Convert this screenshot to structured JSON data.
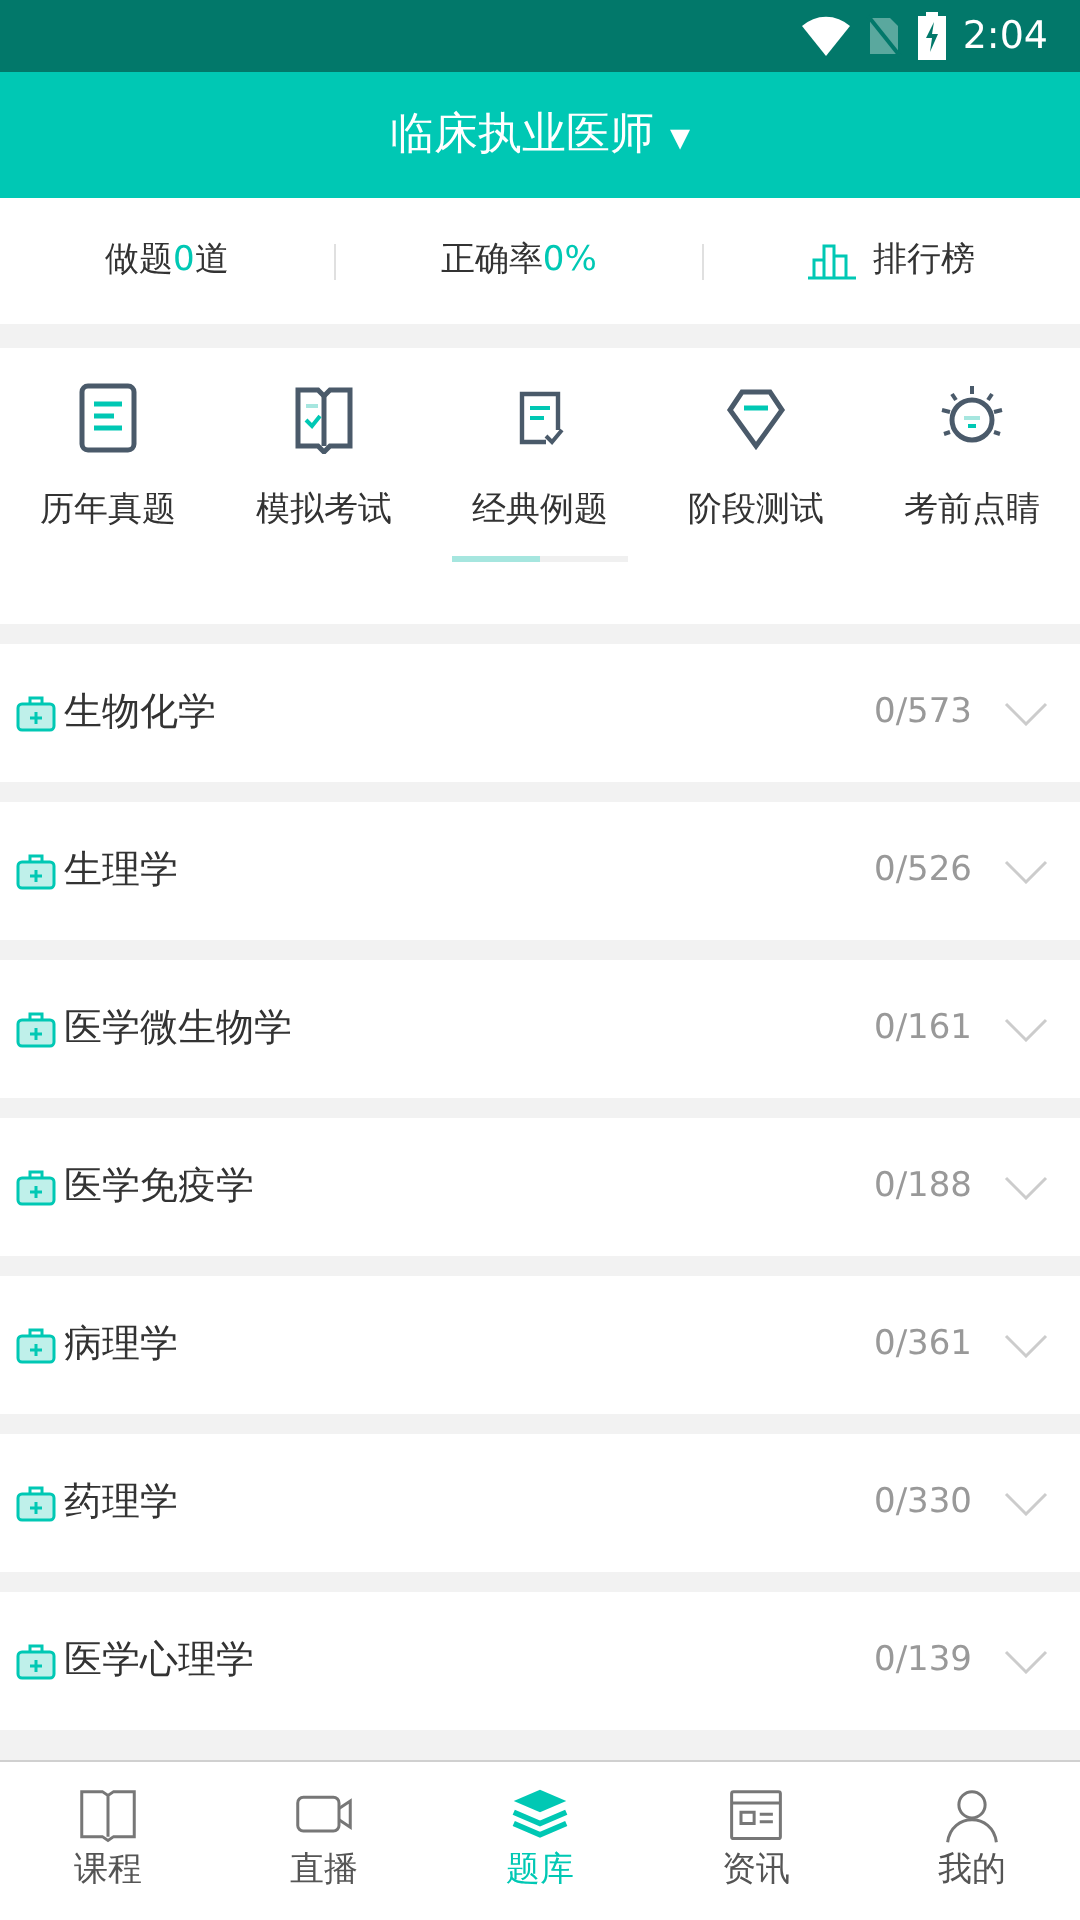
{
  "status_bar": {
    "time": "2:04"
  },
  "header": {
    "title": "临床执业医师",
    "dropdown": "▾"
  },
  "stats": [
    {
      "kind": "stat",
      "text": "做题**0**道"
    },
    {
      "kind": "stat",
      "text": "正确率**0%**"
    },
    {
      "kind": "link",
      "text": "排行榜"
    }
  ],
  "categories": [
    {
      "label": "历年真题",
      "kind": "notes"
    },
    {
      "label": "模拟考试",
      "kind": "book"
    },
    {
      "label": "经典例题",
      "kind": "paper"
    },
    {
      "label": "阶段测试",
      "kind": "gem"
    },
    {
      "label": "考前点睛",
      "kind": "bulb"
    }
  ],
  "subjects": [
    {
      "name": "生物化学",
      "progress": "0/573",
      "expanded": false
    },
    {
      "name": "生理学",
      "progress": "0/526",
      "expanded": false
    },
    {
      "name": "医学微生物学",
      "progress": "0/161",
      "expanded": false
    },
    {
      "name": "医学免疫学",
      "progress": "0/188",
      "expanded": false
    },
    {
      "name": "病理学",
      "progress": "0/361",
      "expanded": false
    },
    {
      "name": "药理学",
      "progress": "0/330",
      "expanded": false
    },
    {
      "name": "医学心理学",
      "progress": "0/139",
      "expanded": false
    }
  ],
  "bottom_nav": [
    {
      "label": "课程",
      "kind": "book",
      "selected": false
    },
    {
      "label": "直播",
      "kind": "video",
      "selected": false
    },
    {
      "label": "题库",
      "kind": "layers",
      "selected": true
    },
    {
      "label": "资讯",
      "kind": "news",
      "selected": false
    },
    {
      "label": "我的",
      "kind": "user",
      "selected": false
    }
  ]
}
